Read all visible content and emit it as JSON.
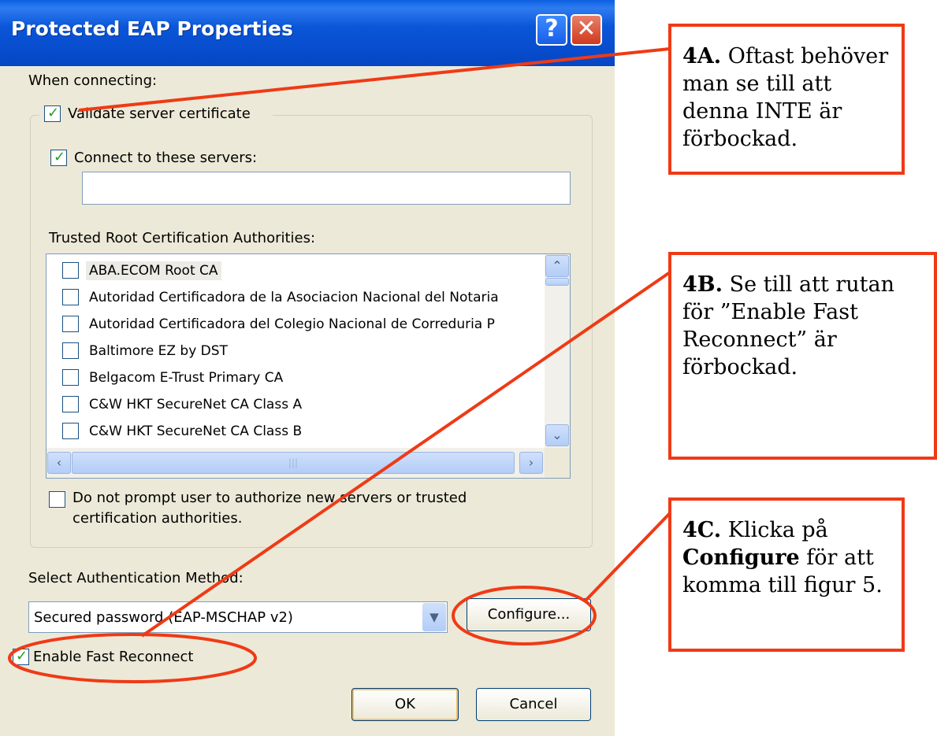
{
  "dialog": {
    "title": "Protected EAP Properties",
    "help_glyph": "?",
    "close_glyph": "✕",
    "when_connecting_label": "When connecting:",
    "validate_server_certificate": {
      "label": "Validate server certificate",
      "checked": true
    },
    "connect_to_these_servers": {
      "label": "Connect to these servers:",
      "checked": true,
      "value": ""
    },
    "trusted_root_label": "Trusted Root Certification Authorities:",
    "trusted_roots": [
      {
        "label": "ABA.ECOM Root CA",
        "checked": false,
        "selected": true
      },
      {
        "label": "Autoridad Certificadora de la Asociacion Nacional del Notaria",
        "checked": false
      },
      {
        "label": "Autoridad Certificadora del Colegio Nacional de Correduria P",
        "checked": false
      },
      {
        "label": "Baltimore EZ by DST",
        "checked": false
      },
      {
        "label": "Belgacom E-Trust Primary CA",
        "checked": false
      },
      {
        "label": "C&W HKT SecureNet CA Class A",
        "checked": false
      },
      {
        "label": "C&W HKT SecureNet CA Class B",
        "checked": false
      }
    ],
    "do_not_prompt": {
      "line1": "Do not prompt user to authorize new servers or trusted",
      "line2": "certification authorities.",
      "checked": false
    },
    "select_auth_method_label": "Select Authentication Method:",
    "auth_method_value": "Secured password (EAP-MSCHAP v2)",
    "configure_button": "Configure...",
    "enable_fast_reconnect": {
      "label": "Enable Fast Reconnect",
      "checked": true
    },
    "ok_button": "OK",
    "cancel_button": "Cancel"
  },
  "callouts": {
    "c4a": {
      "bold": "4A.",
      "text": " Oftast behöver man se till att denna INTE är förbockad."
    },
    "c4b": {
      "bold": "4B.",
      "text": " Se till att rutan för ”Enable Fast Reconnect” är förbockad."
    },
    "c4c": {
      "bold": "4C.",
      "pre": " Klicka på ",
      "bold2": "Configure",
      "post": " för att komma till figur 5."
    }
  },
  "colors": {
    "annotation_red": "#ef3a16",
    "titlebar_blue": "#0a56d8",
    "dialog_bg": "#ece9d8",
    "checkmark_green": "#21a121"
  }
}
